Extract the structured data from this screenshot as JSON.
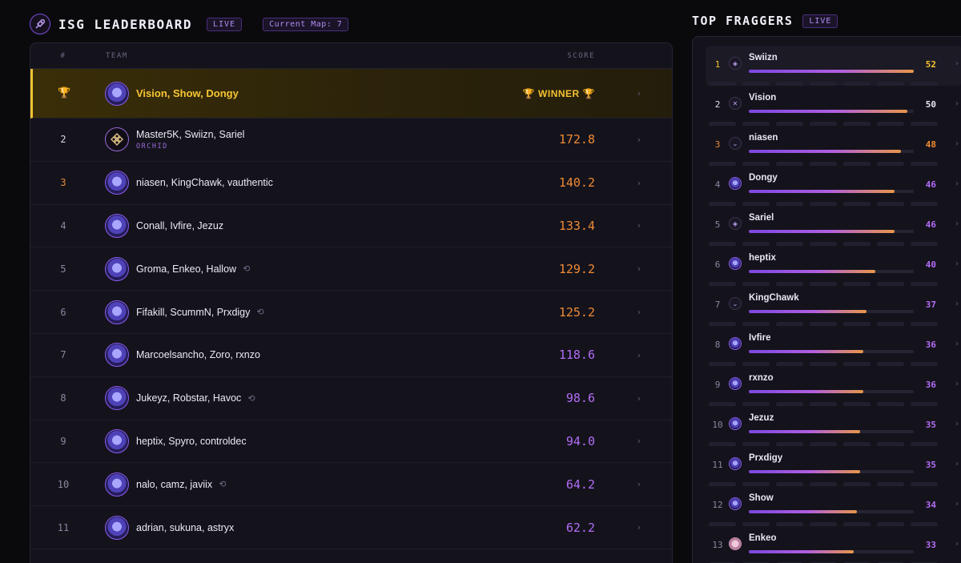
{
  "leaderboard": {
    "title": "ISG LEADERBOARD",
    "live_label": "LIVE",
    "map_label": "Current Map: 7",
    "columns": {
      "rank": "#",
      "team": "TEAM",
      "score": "SCORE"
    },
    "winner_label": "🏆 WINNER 🏆",
    "rows": [
      {
        "rank": "🏆",
        "team": "Vision, Show, Dongy",
        "score": "",
        "winner": true
      },
      {
        "rank": "2",
        "team": "Master5K, Swiizn, Sariel",
        "subtitle": "ORCHID",
        "score": "172.8"
      },
      {
        "rank": "3",
        "team": "niasen, KingChawk, vauthentic",
        "score": "140.2"
      },
      {
        "rank": "4",
        "team": "Conall, Ivfire, Jezuz",
        "score": "133.4"
      },
      {
        "rank": "5",
        "team": "Groma, Enkeo, Hallow",
        "score": "129.2",
        "sub": true
      },
      {
        "rank": "6",
        "team": "Fifakill, ScummN, Prxdigy",
        "score": "125.2",
        "sub": true
      },
      {
        "rank": "7",
        "team": "Marcoelsancho, Zoro, rxnzo",
        "score": "118.6"
      },
      {
        "rank": "8",
        "team": "Jukeyz, Robstar, Havoc",
        "score": "98.6",
        "sub": true
      },
      {
        "rank": "9",
        "team": "heptix, Spyro, controldec",
        "score": "94.0"
      },
      {
        "rank": "10",
        "team": "nalo, camz, javiix",
        "score": "64.2",
        "sub": true
      },
      {
        "rank": "11",
        "team": "adrian, sukuna, astryx",
        "score": "62.2"
      }
    ]
  },
  "fraggers": {
    "title": "TOP FRAGGERS",
    "live_label": "LIVE",
    "max": 52,
    "rows": [
      {
        "rank": "1",
        "name": "Swiizn",
        "value": 52,
        "icon": "orchid-icon"
      },
      {
        "rank": "2",
        "name": "Vision",
        "value": 50,
        "icon": "x-logo-icon"
      },
      {
        "rank": "3",
        "name": "niasen",
        "value": 48,
        "icon": "wing-logo-icon"
      },
      {
        "rank": "4",
        "name": "Dongy",
        "value": 46,
        "icon": "team-logo-icon"
      },
      {
        "rank": "5",
        "name": "Sariel",
        "value": 46,
        "icon": "orchid-icon"
      },
      {
        "rank": "6",
        "name": "heptix",
        "value": 40,
        "icon": "team-logo-icon"
      },
      {
        "rank": "7",
        "name": "KingChawk",
        "value": 37,
        "icon": "wing-logo-icon"
      },
      {
        "rank": "8",
        "name": "Ivfire",
        "value": 36,
        "icon": "team-logo-icon"
      },
      {
        "rank": "9",
        "name": "rxnzo",
        "value": 36,
        "icon": "team-logo-icon"
      },
      {
        "rank": "10",
        "name": "Jezuz",
        "value": 35,
        "icon": "team-logo-icon"
      },
      {
        "rank": "11",
        "name": "Prxdigy",
        "value": 35,
        "icon": "team-logo-icon"
      },
      {
        "rank": "12",
        "name": "Show",
        "value": 34,
        "icon": "team-logo-icon"
      },
      {
        "rank": "13",
        "name": "Enkeo",
        "value": 33,
        "icon": "avatar-icon"
      }
    ]
  },
  "colors": {
    "gold": "#f2c230",
    "orange": "#ef8a34",
    "purple": "#b36cf5",
    "panel": "#14131c"
  }
}
